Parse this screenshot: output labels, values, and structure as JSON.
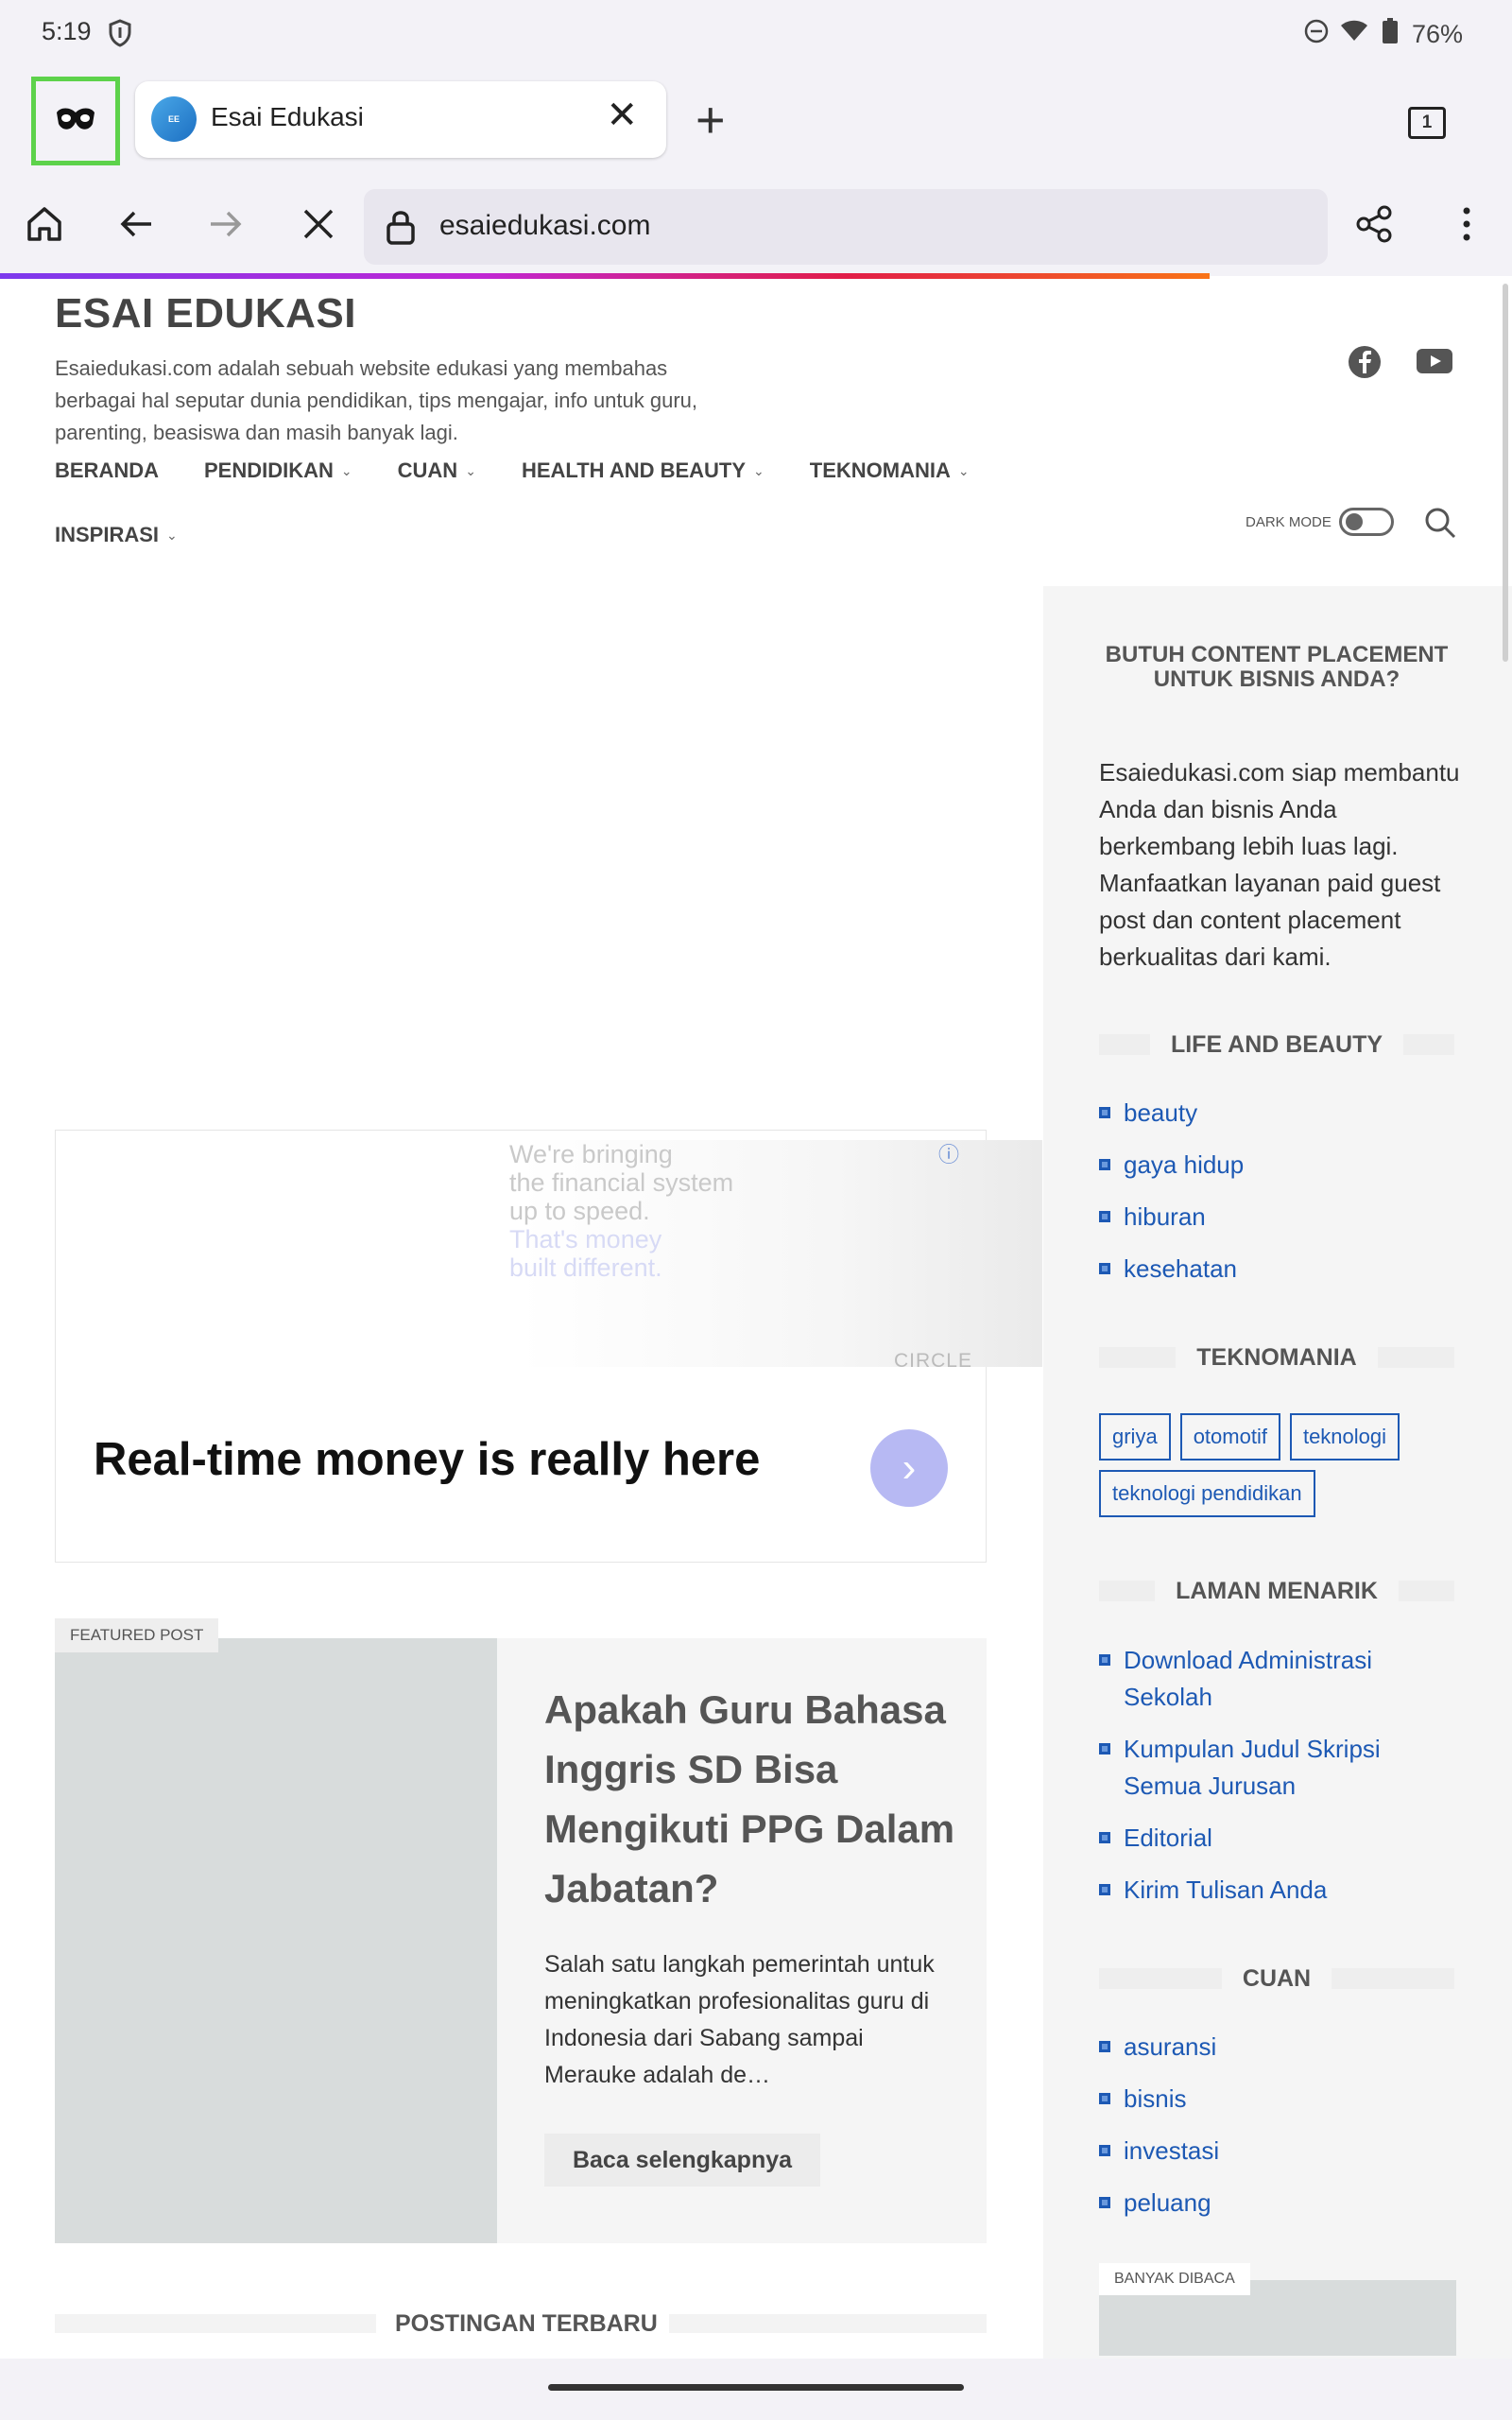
{
  "status": {
    "time": "5:19",
    "battery": "76%"
  },
  "browser": {
    "tab_title": "Esai Edukasi",
    "tab_count": "1",
    "url": "esaiedukasi.com"
  },
  "site": {
    "title": "ESAI EDUKASI",
    "description": "Esaiedukasi.com adalah sebuah website edukasi yang membahas berbagai hal seputar dunia pendidikan, tips mengajar, info untuk guru, parenting, beasiswa dan masih banyak lagi.",
    "nav": [
      "BERANDA",
      "PENDIDIKAN",
      "CUAN",
      "HEALTH AND BEAUTY",
      "TEKNOMANIA"
    ],
    "nav2": "INSPIRASI",
    "dark_mode_label": "DARK MODE"
  },
  "ad": {
    "line1": "We're bringing",
    "line2": "the financial system",
    "line3": "up to speed.",
    "line4": "That's money",
    "line5": "built different.",
    "brand": "CIRCLE",
    "headline": "Real-time money is really here"
  },
  "featured": {
    "label": "FEATURED POST",
    "title": "Apakah Guru Bahasa Inggris SD Bisa Mengikuti PPG Dalam Jabatan?",
    "excerpt": "Salah satu langkah pemerintah untuk meningkatkan profesionalitas guru di Indonesia dari Sabang sampai Merauke adalah de…",
    "read_more": "Baca selengkapnya"
  },
  "recent_title": "POSTINGAN TERBARU",
  "sidebar": {
    "promo_title": "BUTUH CONTENT PLACEMENT UNTUK BISNIS ANDA?",
    "promo_text": "Esaiedukasi.com siap membantu Anda dan bisnis Anda berkembang lebih luas lagi. Manfaatkan layanan paid guest post dan content placement berkualitas dari kami.",
    "life_title": "LIFE AND BEAUTY",
    "life_items": [
      "beauty",
      "gaya hidup",
      "hiburan",
      "kesehatan"
    ],
    "tekno_title": "TEKNOMANIA",
    "tekno_tags": [
      "griya",
      "otomotif",
      "teknologi",
      "teknologi pendidikan"
    ],
    "laman_title": "LAMAN MENARIK",
    "laman_items": [
      "Download Administrasi Sekolah",
      "Kumpulan Judul Skripsi Semua Jurusan",
      "Editorial",
      "Kirim Tulisan Anda"
    ],
    "cuan_title": "CUAN",
    "cuan_items": [
      "asuransi",
      "bisnis",
      "investasi",
      "peluang"
    ],
    "banyak_title": "BANYAK DIBACA"
  },
  "icons": [
    "shield-icon",
    "dnd-icon",
    "wifi-icon",
    "battery-icon",
    "incognito-icon",
    "close-icon",
    "plus-icon",
    "tab-count-icon",
    "home-icon",
    "back-icon",
    "forward-icon",
    "stop-icon",
    "lock-icon",
    "share-icon",
    "more-icon",
    "facebook-icon",
    "youtube-icon",
    "search-icon",
    "arrow-right-icon",
    "info-icon"
  ]
}
